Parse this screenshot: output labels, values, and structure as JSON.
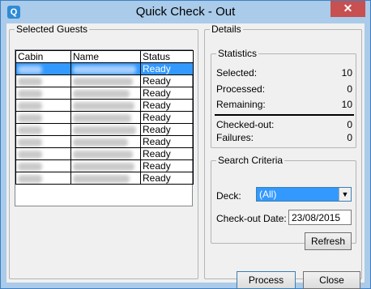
{
  "window": {
    "title": "Quick Check - Out",
    "close_glyph": "✕",
    "icon_glyph": "Q"
  },
  "selected_guests": {
    "legend": "Selected Guests",
    "columns": [
      "Cabin",
      "Name",
      "Status"
    ],
    "rows": [
      {
        "status": "Ready",
        "selected": true
      },
      {
        "status": "Ready"
      },
      {
        "status": "Ready"
      },
      {
        "status": "Ready"
      },
      {
        "status": "Ready"
      },
      {
        "status": "Ready"
      },
      {
        "status": "Ready"
      },
      {
        "status": "Ready"
      },
      {
        "status": "Ready"
      },
      {
        "status": "Ready"
      }
    ]
  },
  "details": {
    "legend": "Details",
    "statistics": {
      "legend": "Statistics",
      "selected_label": "Selected:",
      "selected_value": "10",
      "processed_label": "Processed:",
      "processed_value": "0",
      "remaining_label": "Remaining:",
      "remaining_value": "10",
      "checked_out_label": "Checked-out:",
      "checked_out_value": "0",
      "failures_label": "Failures:",
      "failures_value": "0"
    },
    "search": {
      "legend": "Search Criteria",
      "deck_label": "Deck:",
      "deck_value": "(All)",
      "date_label": "Check-out Date:",
      "date_value": "23/08/2015",
      "refresh_label": "Refresh"
    }
  },
  "buttons": {
    "process_label": "Process",
    "close_label": "Close"
  },
  "colors": {
    "title_bg": "#aacbe9",
    "selection": "#3399ff",
    "close_red": "#c75050"
  }
}
